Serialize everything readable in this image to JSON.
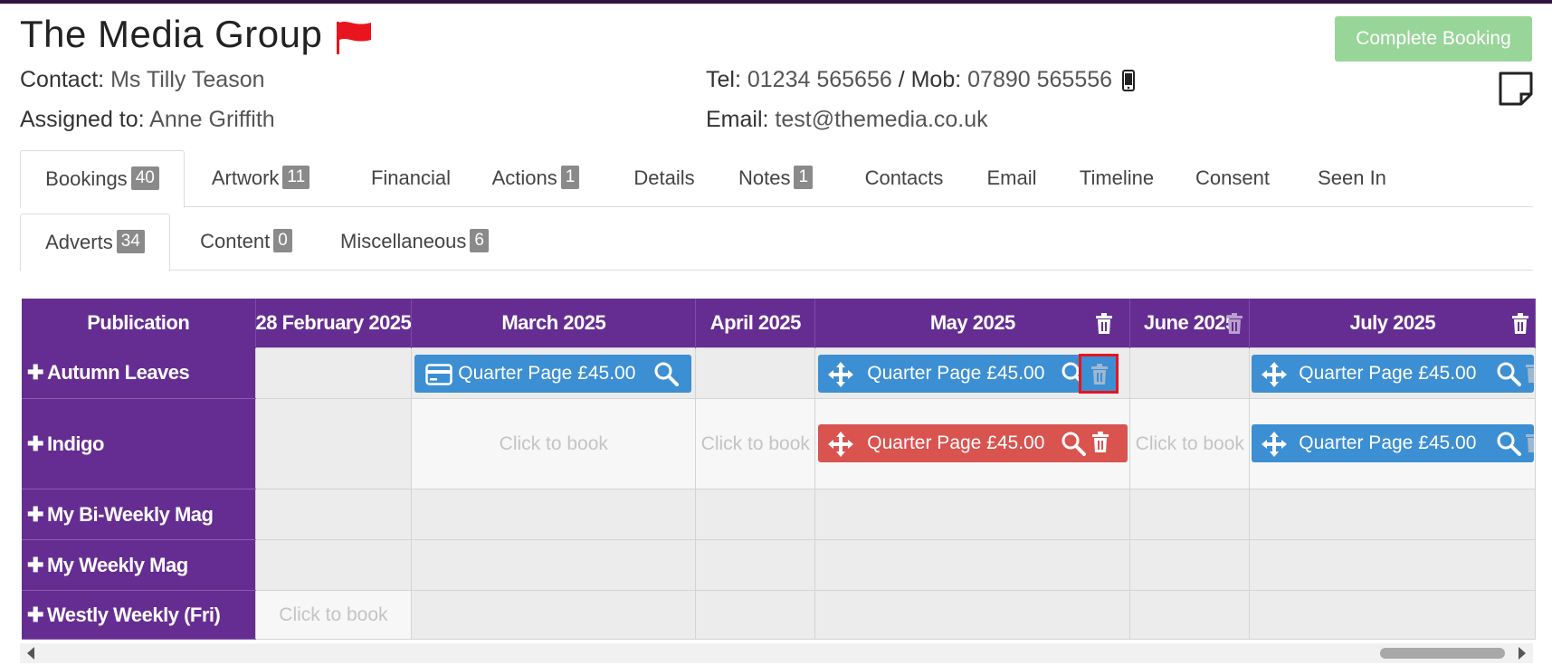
{
  "header": {
    "company": "The Media Group",
    "complete_button": "Complete Booking",
    "contact_label": "Contact:",
    "contact_value": "Ms Tilly Teason",
    "assigned_label": "Assigned to:",
    "assigned_value": "Anne Griffith",
    "tel_label": "Tel:",
    "tel_value": "01234 565656",
    "mob_sep": "/ Mob:",
    "mob_value": "07890 565556",
    "email_label": "Email:",
    "email_value": "test@themedia.co.uk",
    "flag_color": "#e8141e"
  },
  "tabs": [
    {
      "label": "Bookings",
      "badge": "40"
    },
    {
      "label": "Artwork",
      "badge": "11"
    },
    {
      "label": "Financial",
      "badge": ""
    },
    {
      "label": "Actions",
      "badge": "1"
    },
    {
      "label": "Details",
      "badge": ""
    },
    {
      "label": "Notes",
      "badge": "1"
    },
    {
      "label": "Contacts",
      "badge": ""
    },
    {
      "label": "Email",
      "badge": ""
    },
    {
      "label": "Timeline",
      "badge": ""
    },
    {
      "label": "Consent",
      "badge": ""
    },
    {
      "label": "Seen In",
      "badge": ""
    }
  ],
  "subtabs": [
    {
      "label": "Adverts",
      "badge": "34"
    },
    {
      "label": "Content",
      "badge": "0"
    },
    {
      "label": "Miscellaneous",
      "badge": "6"
    }
  ],
  "grid": {
    "columns": [
      "Publication",
      "28 February 2025",
      "March 2025",
      "April 2025",
      "May 2025",
      "June 2025",
      "July 2025"
    ],
    "rows": [
      "Autumn Leaves",
      "Indigo",
      "My Bi-Weekly Mag",
      "My Weekly Mag",
      "Westly Weekly (Fri)"
    ],
    "click_to_book": "Click to book",
    "booking_label": "Quarter Page £45.00"
  },
  "colors": {
    "header_purple": "#652d91",
    "booking_blue": "#3d8fd3",
    "booking_red": "#d9534f",
    "complete_green": "#98d598",
    "highlight": "#e8141e"
  }
}
